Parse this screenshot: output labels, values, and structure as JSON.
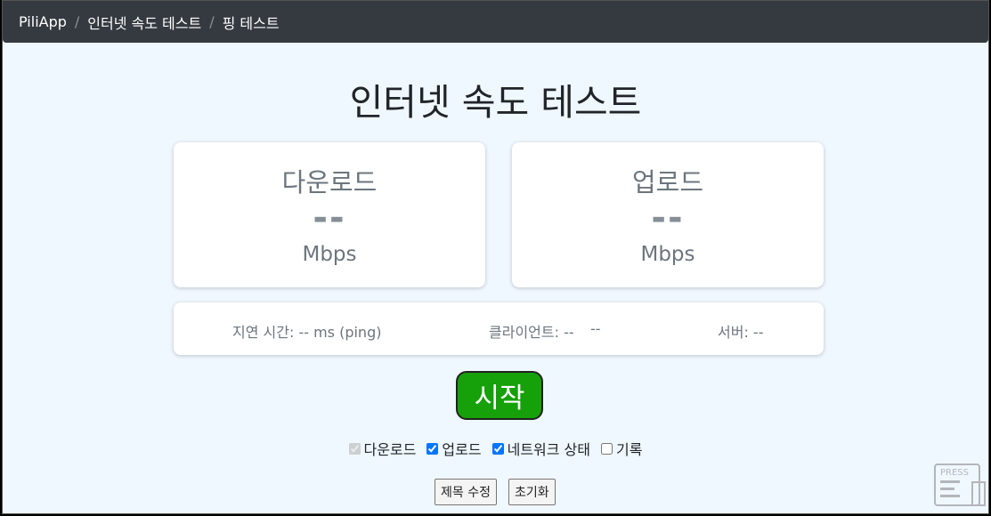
{
  "breadcrumb": [
    "PiliApp",
    "인터넷 속도 테스트",
    "핑 테스트"
  ],
  "breadcrumb_separator": "/",
  "title": "인터넷 속도 테스트",
  "download": {
    "label": "다운로드",
    "value": "--",
    "unit": "Mbps"
  },
  "upload": {
    "label": "업로드",
    "value": "--",
    "unit": "Mbps"
  },
  "info": {
    "latency": "지연 시간: -- ms (ping)",
    "client": "클라이언트: --",
    "client_extra": "--",
    "server": "서버: --"
  },
  "start_button": "시작",
  "options": [
    {
      "label": "다운로드",
      "checked": true,
      "disabled": true
    },
    {
      "label": "업로드",
      "checked": true,
      "disabled": false
    },
    {
      "label": "네트워크 상태",
      "checked": true,
      "disabled": false
    },
    {
      "label": "기록",
      "checked": false,
      "disabled": false
    }
  ],
  "buttons": {
    "edit_title": "제목 수정",
    "reset": "초기화"
  },
  "press_icon": {
    "name": "press-icon",
    "text": "PRESS"
  }
}
